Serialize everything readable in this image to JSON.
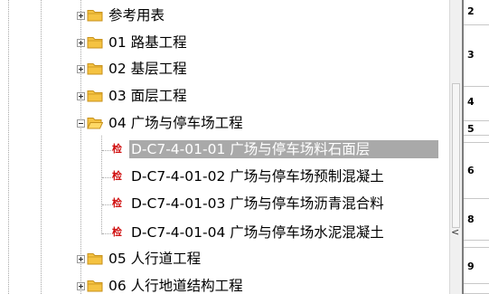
{
  "tree": {
    "items": [
      {
        "id": "ref",
        "label": "参考用表",
        "type": "folder",
        "expander": "plus",
        "selected": false
      },
      {
        "id": "01",
        "label": "01 路基工程",
        "type": "folder",
        "expander": "plus",
        "selected": false
      },
      {
        "id": "02",
        "label": "02 基层工程",
        "type": "folder",
        "expander": "plus",
        "selected": false
      },
      {
        "id": "03",
        "label": "03 面层工程",
        "type": "folder",
        "expander": "plus",
        "selected": false
      },
      {
        "id": "04",
        "label": "04 广场与停车场工程",
        "type": "folder-open",
        "expander": "minus",
        "selected": false
      },
      {
        "id": "04-01",
        "label": "D-C7-4-01-01 广场与停车场料石面层",
        "type": "check",
        "icon_text": "检",
        "selected": true
      },
      {
        "id": "04-02",
        "label": "D-C7-4-01-02 广场与停车场预制混凝土",
        "type": "check",
        "icon_text": "检",
        "selected": false
      },
      {
        "id": "04-03",
        "label": "D-C7-4-01-03 广场与停车场沥青混合料",
        "type": "check",
        "icon_text": "检",
        "selected": false
      },
      {
        "id": "04-04",
        "label": "D-C7-4-01-04 广场与停车场水泥混凝土",
        "type": "check",
        "icon_text": "检",
        "selected": false
      },
      {
        "id": "05",
        "label": "05 人行道工程",
        "type": "folder",
        "expander": "plus",
        "selected": false
      },
      {
        "id": "06",
        "label": "06 人行地道结构工程",
        "type": "folder",
        "expander": "plus",
        "selected": false
      }
    ]
  },
  "scroll": {
    "arrow": "<"
  },
  "grid": {
    "cells": [
      "2",
      "3",
      "4",
      "5",
      "",
      "6",
      "8",
      "",
      "9",
      ""
    ]
  },
  "colors": {
    "selection_bg": "#a9a9a9",
    "check_icon": "#d01010",
    "folder_fill": "#f5c342",
    "folder_border": "#c8921c"
  }
}
